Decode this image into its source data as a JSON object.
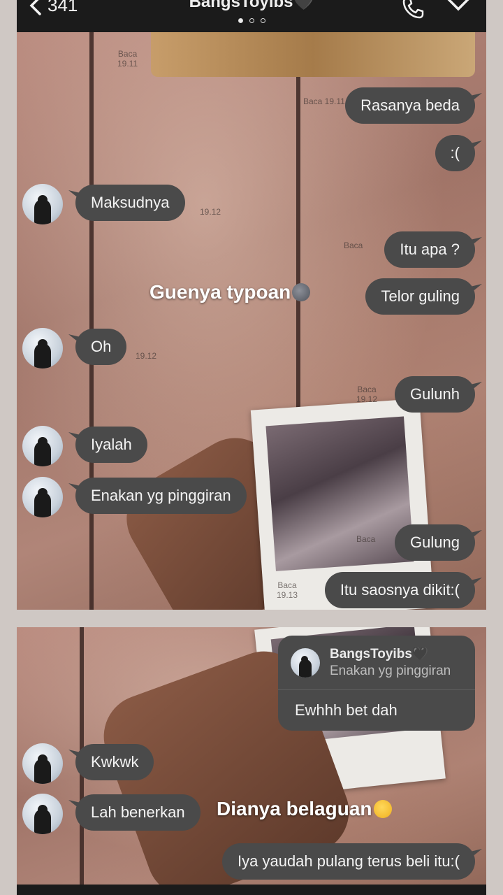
{
  "header": {
    "back_count": "341",
    "title": "BangsToyibs",
    "heart": "🖤"
  },
  "panel1": {
    "messages": [
      {
        "dir": "out",
        "text": "Rasanya beda",
        "meta": "Baca 19.11"
      },
      {
        "dir": "out",
        "text": ":("
      },
      {
        "dir": "in",
        "text": "Maksudnya",
        "meta": "19.12"
      },
      {
        "dir": "out",
        "text": "Itu apa ?",
        "meta": "Baca"
      },
      {
        "dir": "out",
        "text": "Telor guling"
      },
      {
        "dir": "in",
        "text": "Oh",
        "meta": "19.12"
      },
      {
        "dir": "out",
        "text": "Gulunh",
        "meta_read": "Baca",
        "meta_time": "19.12"
      },
      {
        "dir": "in",
        "text": "Iyalah"
      },
      {
        "dir": "in",
        "text": "Enakan yg pinggiran"
      },
      {
        "dir": "out",
        "text": "Gulung",
        "meta": "Baca"
      },
      {
        "dir": "out",
        "text": "Itu saosnya dikit:(",
        "meta_read": "Baca",
        "meta_time": "19.13"
      }
    ],
    "overlay": "Guenya typoan"
  },
  "panel2": {
    "reply": {
      "quoted_name": "BangsToyibs🖤",
      "quoted_text": "Enakan yg pinggiran",
      "text": "Ewhhh bet dah"
    },
    "messages": [
      {
        "dir": "in",
        "text": "Kwkwk"
      },
      {
        "dir": "in",
        "text": "Lah benerkan"
      },
      {
        "dir": "out",
        "text": "Iya yaudah pulang terus beli itu:("
      }
    ],
    "overlay": "Dianya belaguan"
  },
  "colors": {
    "bubble": "#4a4a4a",
    "header": "#1b1b1b"
  }
}
